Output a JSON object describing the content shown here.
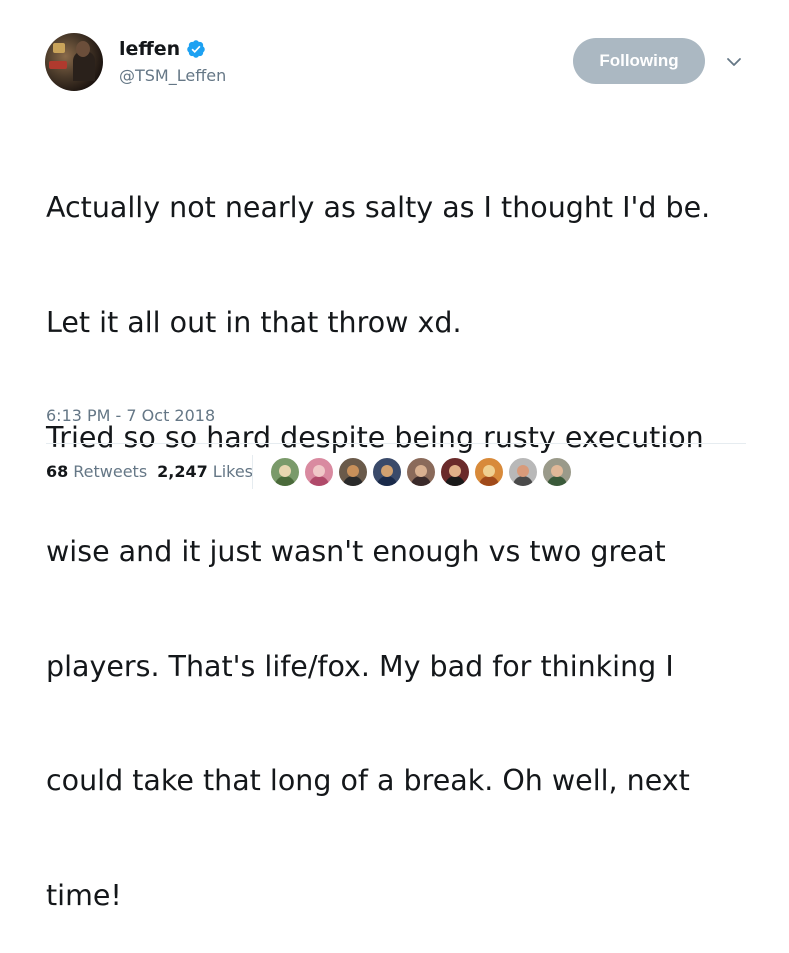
{
  "author": {
    "display_name": "leffen",
    "handle": "@TSM_Leffen",
    "verified": true,
    "avatar_icon": "user-avatar"
  },
  "follow_button": {
    "label": "Following",
    "color": "#abb8c2"
  },
  "menu_icon": "chevron-down-icon",
  "tweet": {
    "lines": [
      "Actually not nearly as salty as I thought I'd be.",
      "Let it all out in that throw xd.",
      "Tried so so hard despite being rusty execution",
      "wise and it just wasn't enough vs two great",
      "players. That's life/fox. My bad for thinking I",
      "could take that long of a break. Oh well, next",
      "time!"
    ]
  },
  "timestamp": "6:13 PM - 7 Oct 2018",
  "stats": {
    "retweets_count": "68",
    "retweets_label": "Retweets",
    "likes_count": "2,247",
    "likes_label": "Likes"
  },
  "liker_avatars": [
    {
      "bg": "#7a9a6a",
      "face": "#e8d6b0",
      "body": "#4a6a3a"
    },
    {
      "bg": "#d98aa0",
      "face": "#f0c8c8",
      "body": "#b04a6a"
    },
    {
      "bg": "#6a5a4a",
      "face": "#c8905a",
      "body": "#2a2a2a"
    },
    {
      "bg": "#3a4a6a",
      "face": "#d0a070",
      "body": "#1a2a4a"
    },
    {
      "bg": "#8a6a5a",
      "face": "#d8b090",
      "body": "#3a2a2a"
    },
    {
      "bg": "#6a2a2a",
      "face": "#e0b088",
      "body": "#1a1a1a"
    },
    {
      "bg": "#d88a3a",
      "face": "#f0d090",
      "body": "#a04a1a"
    },
    {
      "bg": "#b8b8b8",
      "face": "#d89a7a",
      "body": "#4a4a4a"
    },
    {
      "bg": "#9a9a8a",
      "face": "#e0b898",
      "body": "#3a5a3a"
    }
  ],
  "colors": {
    "text_primary": "#14171a",
    "text_secondary": "#657786",
    "verified_blue": "#1da1f2",
    "divider": "#e6ecf0"
  }
}
